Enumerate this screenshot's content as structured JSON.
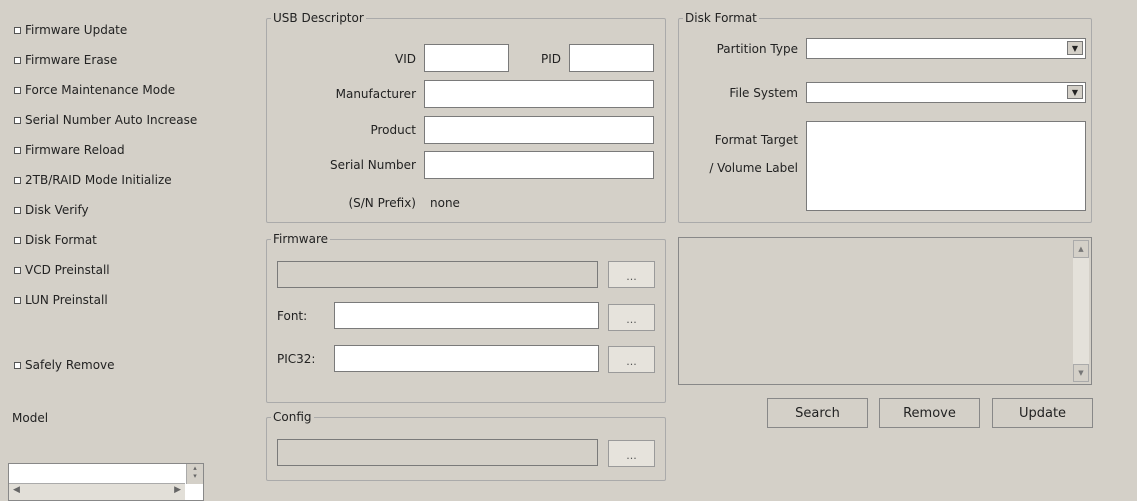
{
  "options": [
    {
      "id": "firmware-update",
      "label": "Firmware Update"
    },
    {
      "id": "firmware-erase",
      "label": "Firmware Erase"
    },
    {
      "id": "force-maintenance-mode",
      "label": "Force Maintenance Mode"
    },
    {
      "id": "serial-number-auto-increase",
      "label": "Serial Number Auto Increase"
    },
    {
      "id": "firmware-reload",
      "label": "Firmware Reload"
    },
    {
      "id": "2tb-raid-mode-initialize",
      "label": "2TB/RAID Mode Initialize"
    },
    {
      "id": "disk-verify",
      "label": "Disk Verify"
    },
    {
      "id": "disk-format",
      "label": "Disk Format"
    },
    {
      "id": "vcd-preinstall",
      "label": "VCD Preinstall"
    },
    {
      "id": "lun-preinstall",
      "label": "LUN Preinstall"
    },
    {
      "id": "safely-remove",
      "label": "Safely Remove"
    }
  ],
  "model": {
    "label": "Model"
  },
  "usb": {
    "title": "USB Descriptor",
    "vid_label": "VID",
    "vid_value": "",
    "pid_label": "PID",
    "pid_value": "",
    "manufacturer_label": "Manufacturer",
    "manufacturer_value": "",
    "product_label": "Product",
    "product_value": "",
    "serial_label": "Serial Number",
    "serial_value": "",
    "sn_prefix_label": "(S/N Prefix)",
    "sn_prefix_value": "none"
  },
  "firmware": {
    "title": "Firmware",
    "path_value": "",
    "font_label": "Font:",
    "font_value": "",
    "pic32_label": "PIC32:",
    "pic32_value": "",
    "browse_label": "..."
  },
  "config": {
    "title": "Config",
    "path_value": "",
    "browse_label": "..."
  },
  "disk_format": {
    "title": "Disk Format",
    "partition_type_label": "Partition Type",
    "partition_type_value": "",
    "file_system_label": "File System",
    "file_system_value": "",
    "format_target_label": "Format Target",
    "volume_label_label": "/ Volume Label"
  },
  "buttons": {
    "search": "Search",
    "remove": "Remove",
    "update": "Update"
  }
}
